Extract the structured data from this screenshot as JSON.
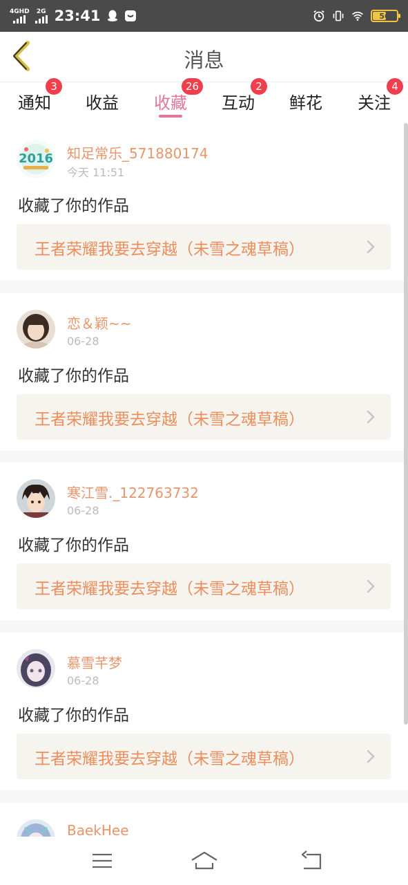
{
  "status_bar": {
    "network1": "4GHD",
    "network2": "2G",
    "time": "23:41",
    "battery": "56",
    "battery_level": 0.56
  },
  "header": {
    "title": "消息"
  },
  "tabs": [
    {
      "label": "通知",
      "badge": "3",
      "active": false
    },
    {
      "label": "收益",
      "badge": "",
      "active": false
    },
    {
      "label": "收藏",
      "badge": "26",
      "active": true
    },
    {
      "label": "互动",
      "badge": "2",
      "active": false
    },
    {
      "label": "鲜花",
      "badge": "",
      "active": false
    },
    {
      "label": "关注",
      "badge": "4",
      "active": false
    }
  ],
  "messages": [
    {
      "username": "知足常乐_571880174",
      "date": "今天 11:51",
      "action": "收藏了你的作品",
      "work_title": "王者荣耀我要去穿越（未雪之魂草稿）",
      "avatar": "new-year-2016-avatar"
    },
    {
      "username": "恋＆颖~~",
      "date": "06-28",
      "action": "收藏了你的作品",
      "work_title": "王者荣耀我要去穿越（未雪之魂草稿）",
      "avatar": "girl-photo-avatar"
    },
    {
      "username": "寒江雪._122763732",
      "date": "06-28",
      "action": "收藏了你的作品",
      "work_title": "王者荣耀我要去穿越（未雪之魂草稿）",
      "avatar": "anime-boy-avatar"
    },
    {
      "username": "慕雪芊梦",
      "date": "06-28",
      "action": "收藏了你的作品",
      "work_title": "王者荣耀我要去穿越（未雪之魂草稿）",
      "avatar": "anime-girl-avatar"
    },
    {
      "username": "BaekHee",
      "date": "",
      "action": "",
      "work_title": "",
      "avatar": "anime-avatar"
    }
  ],
  "colors": {
    "accent": "#e0779a",
    "username": "#e9956c",
    "work_title": "#ec8e5c",
    "badge": "#ef3f4d"
  }
}
